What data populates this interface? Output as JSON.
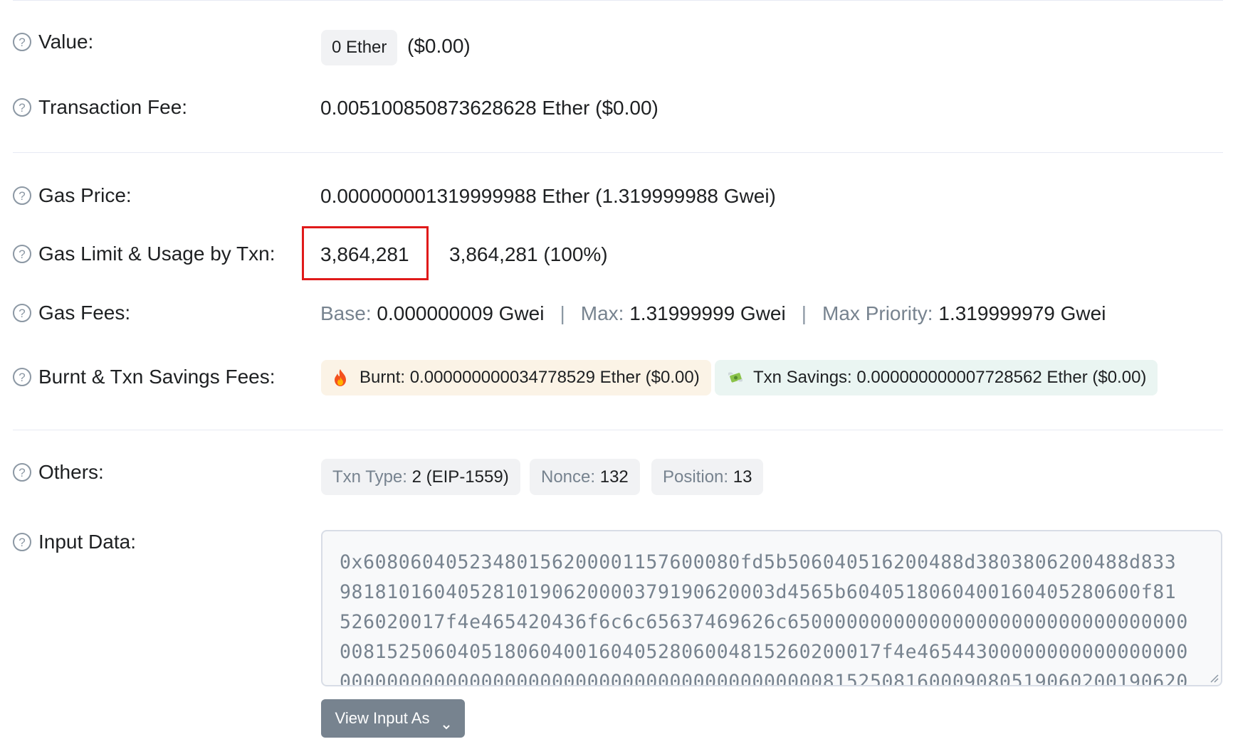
{
  "rows": {
    "value": {
      "label": "Value:",
      "amount_pill": "0 Ether",
      "usd": "($0.00)"
    },
    "txn_fee": {
      "label": "Transaction Fee:",
      "value": "0.005100850873628628 Ether ($0.00)"
    },
    "gas_price": {
      "label": "Gas Price:",
      "value": "0.000000001319999988 Ether (1.319999988 Gwei)"
    },
    "gas_limit": {
      "label": "Gas Limit & Usage by Txn:",
      "limit": "3,864,281",
      "usage": "3,864,281 (100%)"
    },
    "gas_fees": {
      "label": "Gas Fees:",
      "base_label": "Base:",
      "base_value": "0.000000009 Gwei",
      "max_label": "Max:",
      "max_value": "1.31999999 Gwei",
      "priority_label": "Max Priority:",
      "priority_value": "1.319999979 Gwei",
      "separator": "|"
    },
    "burnt": {
      "label": "Burnt & Txn Savings Fees:",
      "burnt_icon": "fire-icon",
      "burnt_text": "Burnt: 0.000000000034778529 Ether ($0.00)",
      "savings_icon": "money-wings-icon",
      "savings_text": "Txn Savings: 0.000000000007728562 Ether ($0.00)",
      "burnt_bg": "#fbf3e6",
      "savings_bg": "#eaf5f2"
    },
    "others": {
      "label": "Others:",
      "txn_type_label": "Txn Type:",
      "txn_type_value": "2 (EIP-1559)",
      "nonce_label": "Nonce:",
      "nonce_value": "132",
      "position_label": "Position:",
      "position_value": "13"
    },
    "input_data": {
      "label": "Input Data:",
      "lines": [
        "0x60806040523480156200001157600080fd5b506040516200488d3803806200488d833",
        "9818101604052810190620000379190620003d4565b6040518060400160405280600f81",
        "526020017f4e465420436f6c6c65637469626c6500000000000000000000000000000000",
        "0081525060405180604001604052806004815260200017f4e46544300000000000000000",
        "000000000000000000000000000000000000000008152508160009080519060200190620"
      ],
      "button_label": "View Input As"
    }
  },
  "colors": {
    "highlight_box": "#e01a1a",
    "muted_text": "#77838f",
    "button_bg": "#77838f"
  }
}
